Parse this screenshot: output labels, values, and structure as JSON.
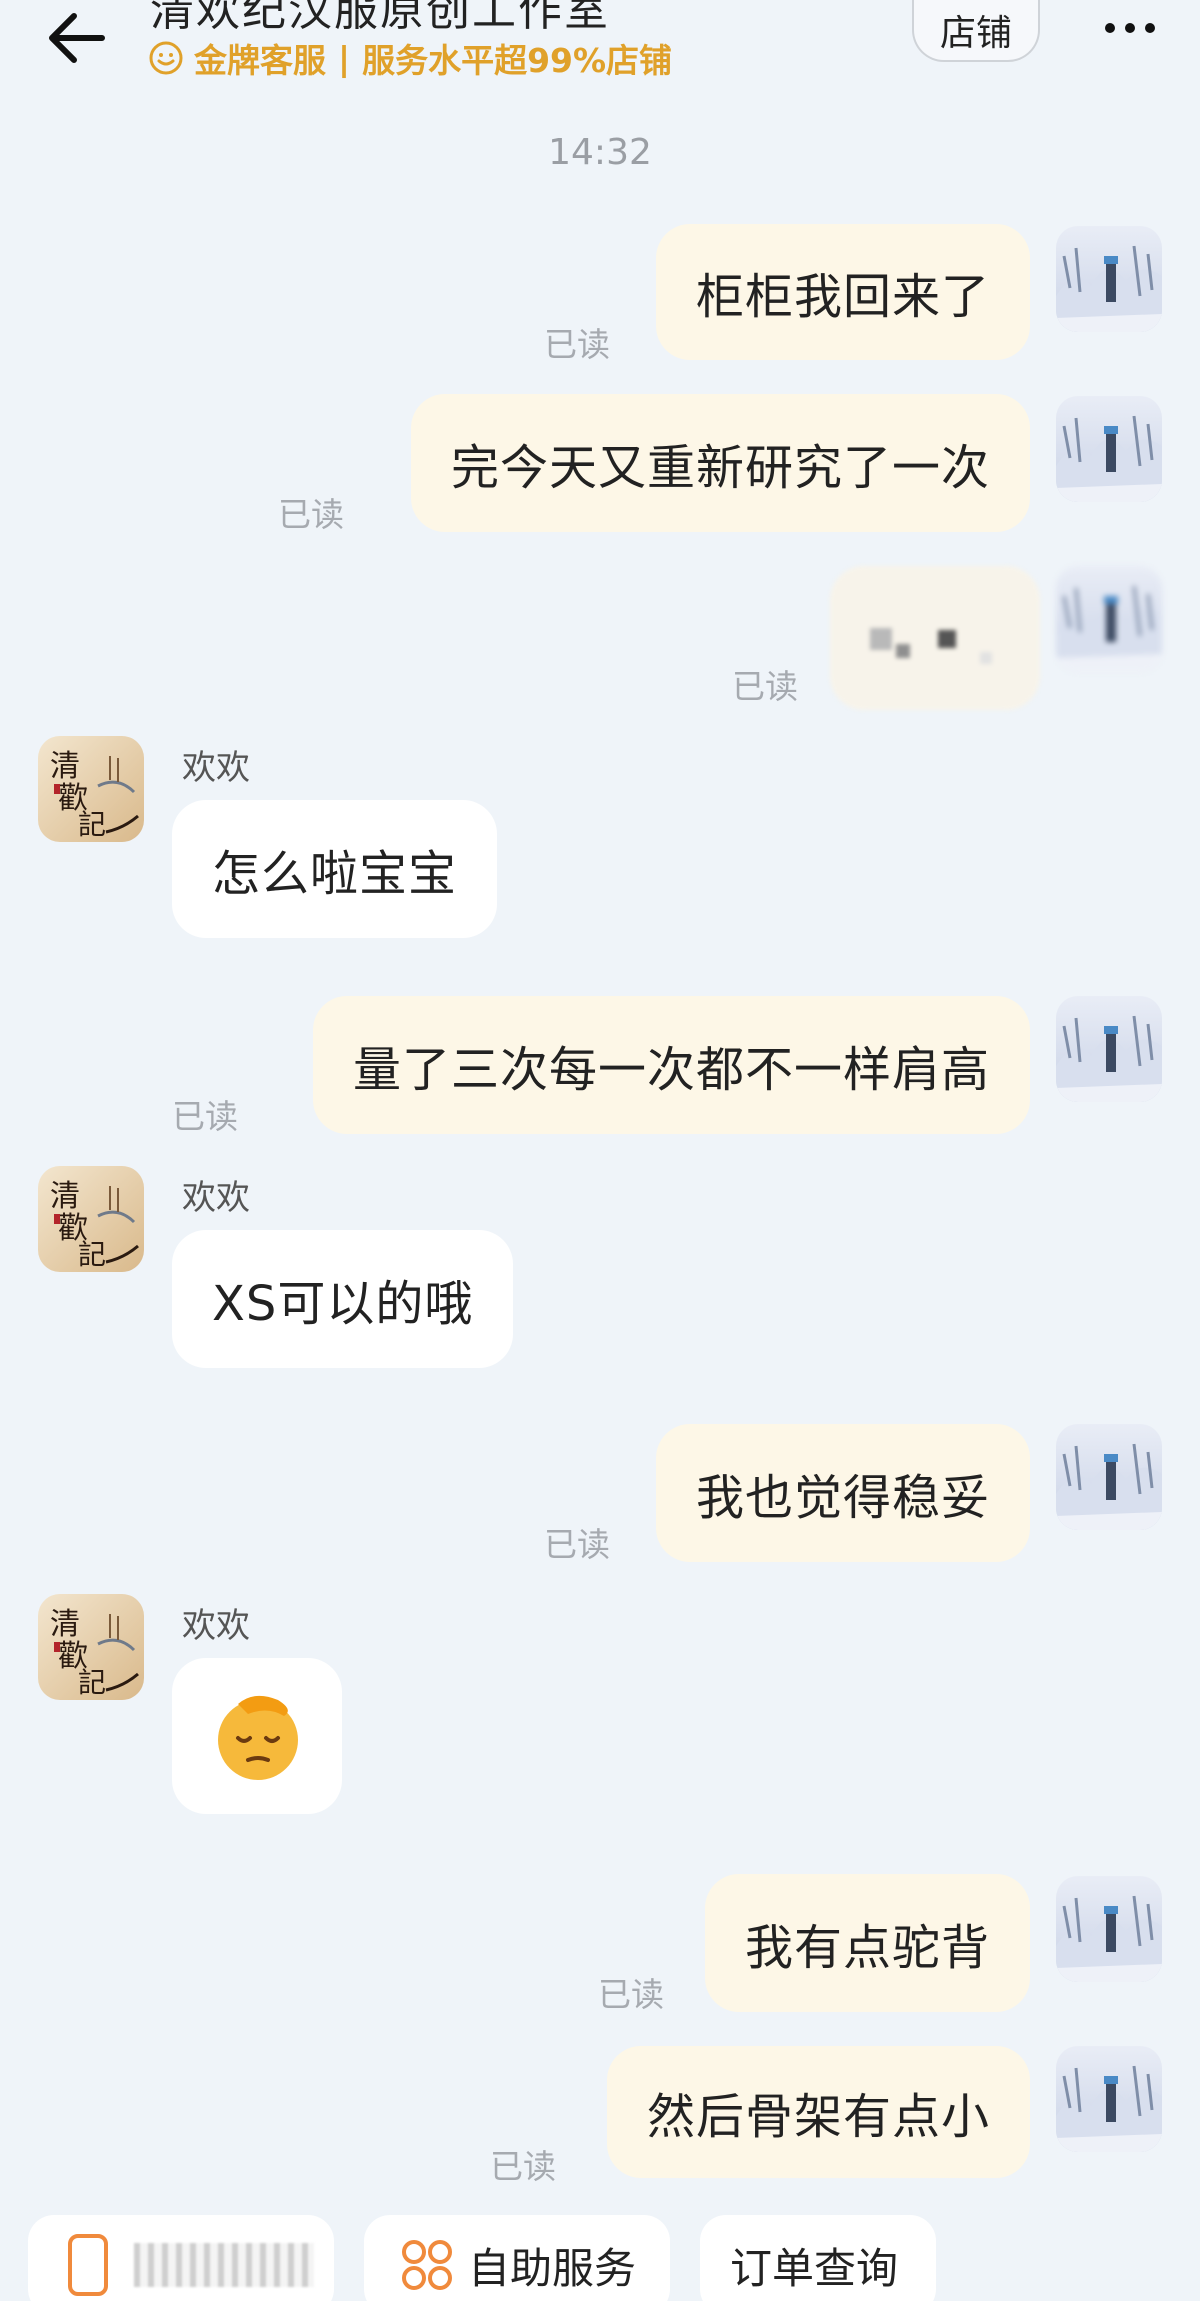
{
  "header": {
    "title": "清欢纪汉服原创工作室",
    "badge_label": "金牌客服",
    "separator": "|",
    "service_text": "服务水平超99%店铺",
    "store_button": "店铺",
    "accent_color": "#e0a12a"
  },
  "chat": {
    "timestamp": "14:32",
    "agent_name": "欢欢",
    "read_label": "已读",
    "messages": [
      {
        "from": "me",
        "text": "柜柜我回来了",
        "status": "已读"
      },
      {
        "from": "me",
        "text": "完今天又重新研究了一次",
        "status": "已读"
      },
      {
        "from": "me",
        "text": "",
        "status": "已读",
        "type": "image-blurred"
      },
      {
        "from": "agent",
        "sender": "欢欢",
        "text": "怎么啦宝宝"
      },
      {
        "from": "me",
        "text": "量了三次每一次都不一样肩高",
        "status": "已读"
      },
      {
        "from": "agent",
        "sender": "欢欢",
        "text": "XS可以的哦"
      },
      {
        "from": "me",
        "text": "我也觉得稳妥",
        "status": "已读"
      },
      {
        "from": "agent",
        "sender": "欢欢",
        "text": "",
        "type": "emoji",
        "emoji": "😔"
      },
      {
        "from": "me",
        "text": "我有点驼背",
        "status": "已读"
      },
      {
        "from": "me",
        "text": "然后骨架有点小",
        "status": "已读"
      }
    ]
  },
  "bottom_bar": {
    "self_service": "自助服务",
    "order_query": "订单查询"
  },
  "icons": {
    "back": "back-arrow-icon",
    "more": "more-dots-icon",
    "badge": "smile-badge-icon",
    "self_service": "grid-circles-icon"
  }
}
